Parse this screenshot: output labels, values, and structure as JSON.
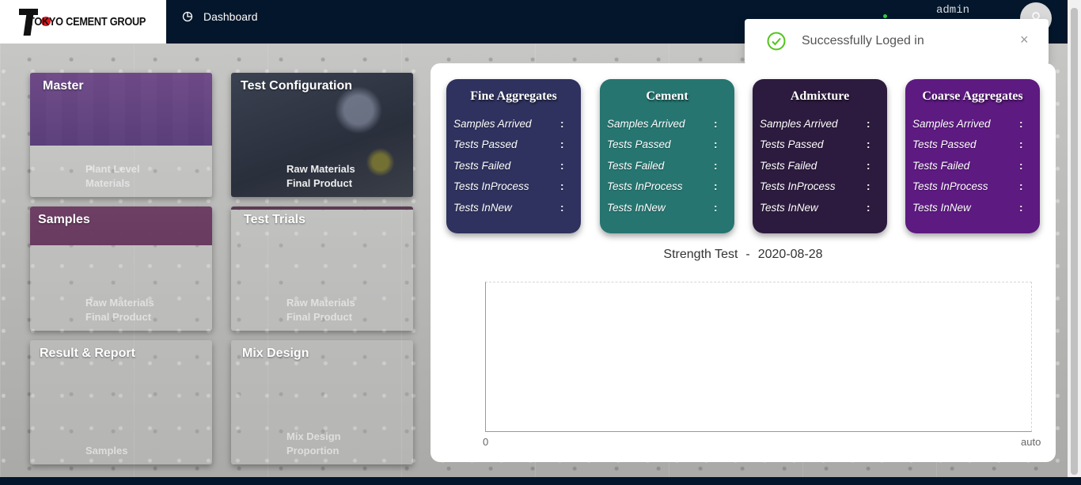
{
  "header": {
    "brand": "TOKYO CEMENT GROUP",
    "nav_item": "Dashboard",
    "username": "admin"
  },
  "toast": {
    "message": "Successfully Loged in",
    "close_label": "×"
  },
  "tiles": [
    {
      "title": "Master",
      "sub1": "Plant Level",
      "sub2": "Materials"
    },
    {
      "title": "Test Configuration",
      "sub1": "Raw Materials",
      "sub2": "Final Product"
    },
    {
      "title": "Samples",
      "sub1": "Raw Materials",
      "sub2": "Final Product"
    },
    {
      "title": "Test Trials",
      "sub1": "Raw Materials",
      "sub2": "Final Product"
    },
    {
      "title": "Result & Report",
      "sub1": "",
      "sub2": "Samples"
    },
    {
      "title": "Mix Design",
      "sub1": "Mix Design",
      "sub2": "Proportion"
    }
  ],
  "cards": [
    {
      "title": "Fine Aggregates",
      "color": "#2f325e"
    },
    {
      "title": "Cement",
      "color": "#267570"
    },
    {
      "title": "Admixture",
      "color": "#2d1b3f"
    },
    {
      "title": "Coarse Aggregates",
      "color": "#5d1a80"
    }
  ],
  "card_rows": [
    "Samples Arrived",
    "Tests Passed",
    "Tests Failed",
    "Tests InProcess",
    "Tests InNew"
  ],
  "card_colon": ":",
  "chart": {
    "title": "Strength Test",
    "separator": "-",
    "date": "2020-08-28",
    "x_min_label": "0",
    "x_max_label": "auto"
  }
}
